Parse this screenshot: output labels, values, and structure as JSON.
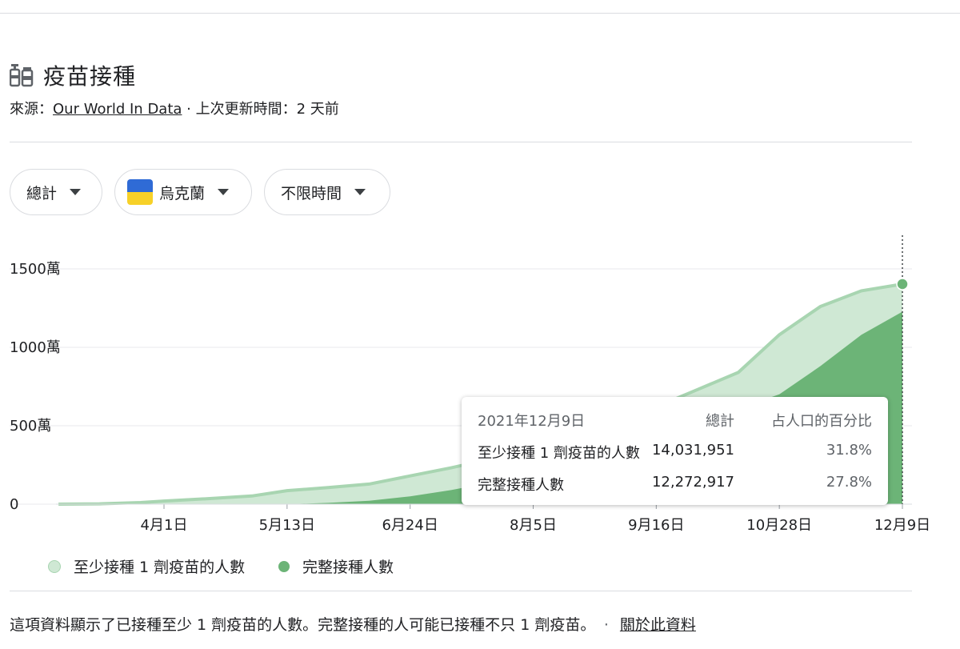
{
  "header": {
    "title": "疫苗接種",
    "icon": "vaccine-icon"
  },
  "source": {
    "prefix": "來源：",
    "link": "Our World In Data",
    "separator": " · ",
    "updated": "上次更新時間：2 天前"
  },
  "filters": [
    {
      "label": "總計",
      "icon": "chevron-down-icon"
    },
    {
      "label": "烏克蘭",
      "icon": "ukraine-flag-icon",
      "flag_colors": [
        "#2f6bd6",
        "#f7d128"
      ]
    },
    {
      "label": "不限時間",
      "icon": "chevron-down-icon"
    }
  ],
  "tooltip": {
    "date": "2021年12月9日",
    "col_total": "總計",
    "col_percent": "占人口的百分比",
    "rows": [
      {
        "label": "至少接種 1 劑疫苗的人數",
        "total": "14,031,951",
        "percent": "31.8%"
      },
      {
        "label": "完整接種人數",
        "total": "12,272,917",
        "percent": "27.8%"
      }
    ]
  },
  "legend": [
    {
      "label": "至少接種 1 劑疫苗的人數",
      "color": "#cfe8d4"
    },
    {
      "label": "完整接種人數",
      "color": "#6cb477"
    }
  ],
  "footer": {
    "text": "這項資料顯示了已接種至少 1 劑疫苗的人數。完整接種的人可能已接種不只 1 劑疫苗。",
    "separator": "·",
    "link": "關於此資料"
  },
  "chart_data": {
    "type": "area",
    "y_unit": "萬",
    "ylim": [
      0,
      1500
    ],
    "y_ticks": [
      {
        "value": 0,
        "label": "0"
      },
      {
        "value": 500,
        "label": "500萬"
      },
      {
        "value": 1000,
        "label": "1000萬"
      },
      {
        "value": 1500,
        "label": "1500萬"
      }
    ],
    "x_ticks": [
      "4月1日",
      "5月13日",
      "6月24日",
      "8月5日",
      "9月16日",
      "10月28日",
      "12月9日"
    ],
    "colors": {
      "first_dose": "#cfe8d4",
      "first_dose_line": "#a8d5b1",
      "fully": "#6cb477",
      "grid": "#e8eaed"
    },
    "series": [
      {
        "name": "至少接種 1 劑疫苗的人數",
        "dates": [
          "2月24日",
          "3月10日",
          "3月24日",
          "4月1日",
          "4月15日",
          "5月1日",
          "5月13日",
          "5月27日",
          "6月10日",
          "6月24日",
          "7月8日",
          "7月22日",
          "8月5日",
          "8月19日",
          "9月2日",
          "9月16日",
          "9月30日",
          "10月14日",
          "10月28日",
          "11月11日",
          "11月25日",
          "12月9日"
        ],
        "values": [
          0,
          2,
          10,
          20,
          34,
          52,
          86,
          106,
          128,
          180,
          232,
          290,
          360,
          430,
          520,
          620,
          730,
          840,
          1080,
          1260,
          1360,
          1403
        ]
      },
      {
        "name": "完整接種人數",
        "dates": [
          "5月13日",
          "5月27日",
          "6月10日",
          "6月24日",
          "7月8日",
          "7月22日",
          "8月5日",
          "8月19日",
          "9月2日",
          "9月16日",
          "9月30日",
          "10月14日",
          "10月28日",
          "11月11日",
          "11月25日",
          "12月9日"
        ],
        "values": [
          0,
          8,
          22,
          50,
          90,
          140,
          200,
          270,
          340,
          420,
          520,
          610,
          700,
          880,
          1080,
          1227
        ]
      }
    ],
    "highlight": {
      "date": "12月9日",
      "value": 1403
    }
  }
}
